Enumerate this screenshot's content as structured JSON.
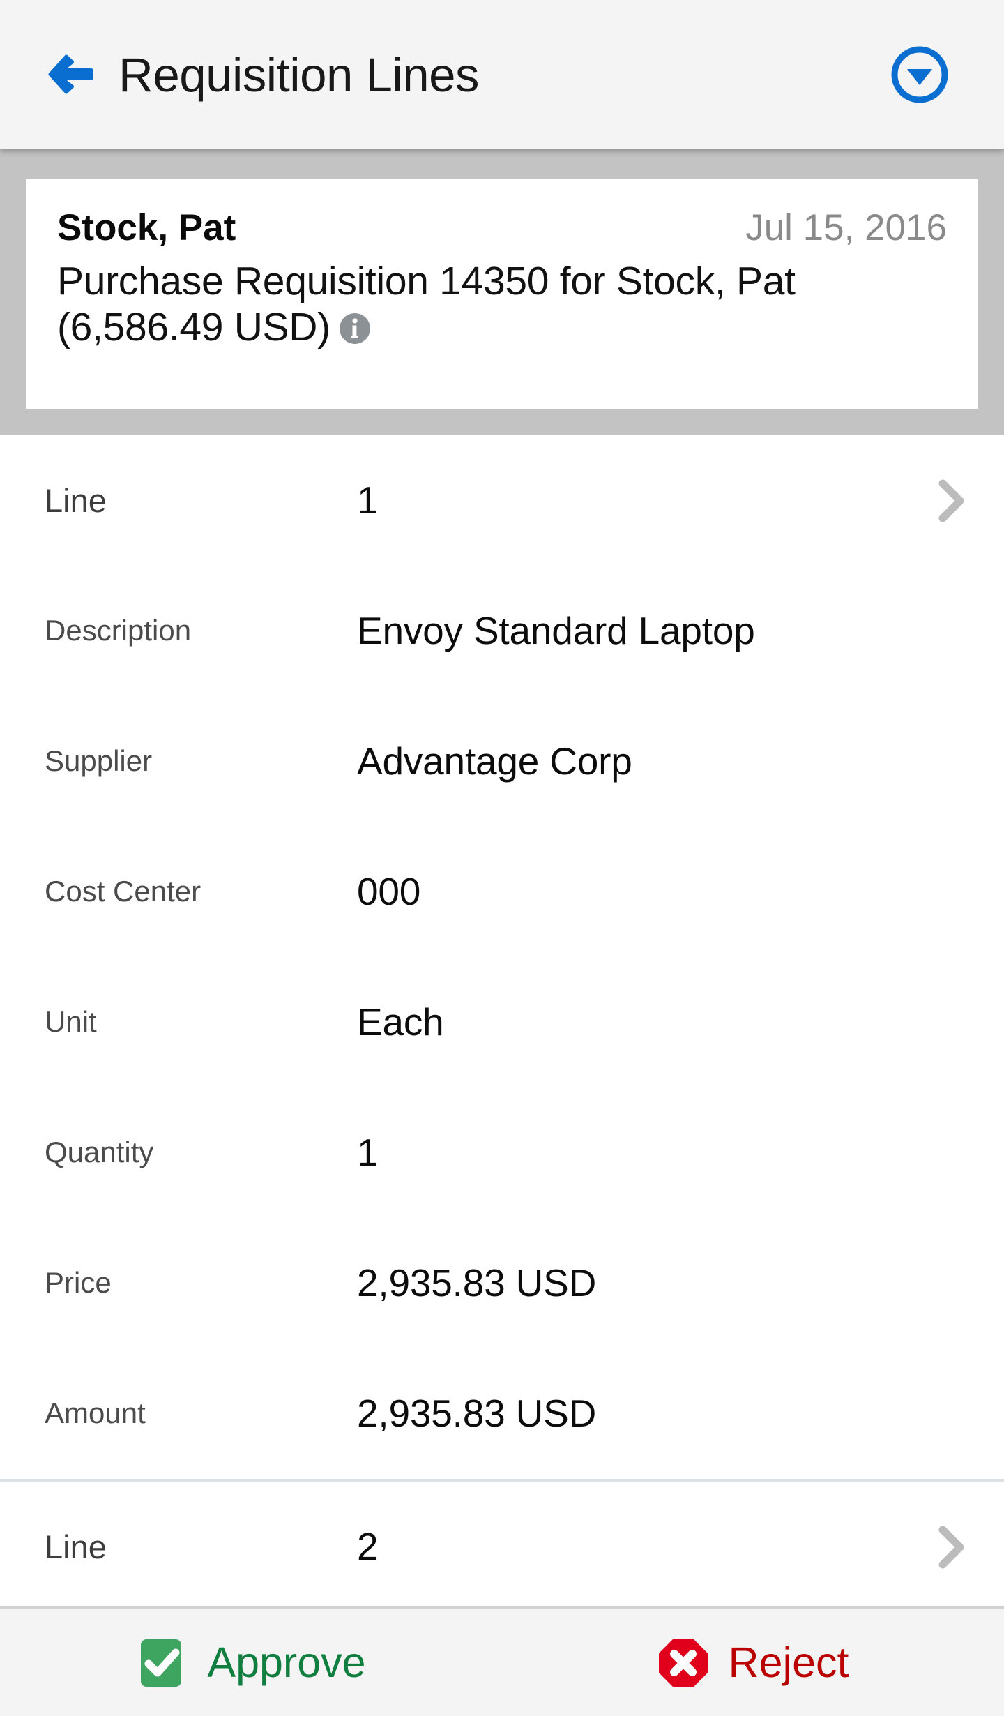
{
  "header": {
    "title": "Requisition Lines",
    "back_icon": "arrow-left-icon",
    "action_icon": "chevron-down-circle-icon",
    "accent_color": "#0a6ed1",
    "background": "#f4f4f5"
  },
  "card": {
    "requester": "Stock, Pat",
    "date": "Jul 15, 2016",
    "description": "Purchase Requisition 14350 for Stock, Pat (6,586.49 USD)",
    "info_icon": "info-icon",
    "info_icon_color": "#8c9196",
    "band_color": "#c3c3c3"
  },
  "lines": [
    {
      "rows": [
        {
          "label": "Line",
          "value": "1",
          "chevron": true,
          "emphasis": true
        },
        {
          "label": "Description",
          "value": "Envoy Standard Laptop",
          "chevron": false,
          "emphasis": false
        },
        {
          "label": "Supplier",
          "value": "Advantage Corp",
          "chevron": false,
          "emphasis": false
        },
        {
          "label": "Cost Center",
          "value": "000",
          "chevron": false,
          "emphasis": false
        },
        {
          "label": "Unit",
          "value": "Each",
          "chevron": false,
          "emphasis": false
        },
        {
          "label": "Quantity",
          "value": "1",
          "chevron": false,
          "emphasis": false
        },
        {
          "label": "Price",
          "value": "2,935.83 USD",
          "chevron": false,
          "emphasis": false
        },
        {
          "label": "Amount",
          "value": "2,935.83 USD",
          "chevron": false,
          "emphasis": false
        }
      ]
    },
    {
      "rows": [
        {
          "label": "Line",
          "value": "2",
          "chevron": true,
          "emphasis": true
        }
      ]
    }
  ],
  "footer": {
    "approve_label": "Approve",
    "approve_icon": "check-square-icon",
    "approve_color": "#107e3e",
    "approve_icon_color": "#3da55f",
    "reject_label": "Reject",
    "reject_icon": "x-octagon-icon",
    "reject_color": "#bb0000",
    "reject_icon_color": "#e0001b"
  }
}
